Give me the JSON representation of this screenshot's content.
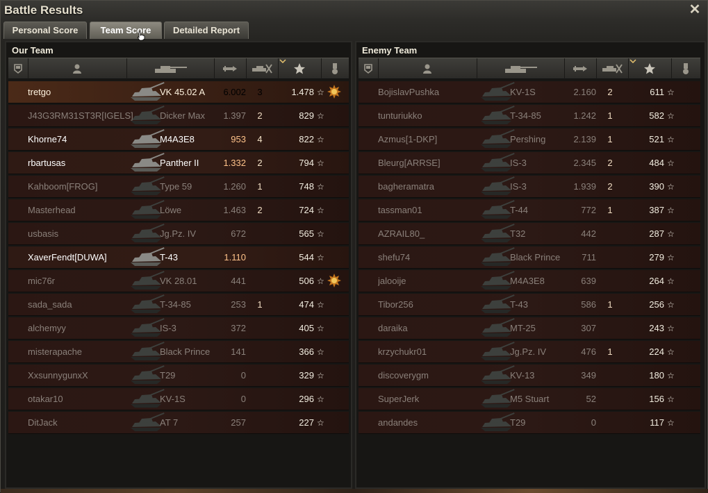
{
  "window": {
    "title": "Battle Results",
    "close_symbol": "✕"
  },
  "tabs": [
    {
      "label": "Personal Score",
      "active": false
    },
    {
      "label": "Team Score",
      "active": true
    },
    {
      "label": "Detailed Report",
      "active": false
    }
  ],
  "our_team": {
    "title": "Our Team",
    "columns": [
      "squad-icon",
      "player-icon",
      "vehicle-icon",
      "damage-icon",
      "kills-icon",
      "experience-star-icon",
      "medal-icon"
    ],
    "rows": [
      {
        "name": "tretgo",
        "vehicle": "VK 45.02 A",
        "damage": "6.002",
        "kills": "3",
        "xp": "1.478",
        "state": "player",
        "medal": true
      },
      {
        "name": "J43G3RM31ST3R[IGELS]",
        "vehicle": "Dicker Max",
        "damage": "1.397",
        "kills": "2",
        "xp": "829",
        "state": "dead",
        "medal": false
      },
      {
        "name": "Khorne74",
        "vehicle": "M4A3E8",
        "damage": "953",
        "kills": "4",
        "xp": "822",
        "state": "alive",
        "medal": false
      },
      {
        "name": "rbartusas",
        "vehicle": "Panther II",
        "damage": "1.332",
        "kills": "2",
        "xp": "794",
        "state": "alive",
        "medal": false
      },
      {
        "name": "Kahboom[FROG]",
        "vehicle": "Type 59",
        "damage": "1.260",
        "kills": "1",
        "xp": "748",
        "state": "dead",
        "medal": false
      },
      {
        "name": "Masterhead",
        "vehicle": "Löwe",
        "damage": "1.463",
        "kills": "2",
        "xp": "724",
        "state": "dead",
        "medal": false
      },
      {
        "name": "usbasis",
        "vehicle": "Jg.Pz. IV",
        "damage": "672",
        "kills": "",
        "xp": "565",
        "state": "dead",
        "medal": false
      },
      {
        "name": "XaverFendt[DUWA]",
        "vehicle": "T-43",
        "damage": "1.110",
        "kills": "",
        "xp": "544",
        "state": "alive",
        "medal": false
      },
      {
        "name": "mic76r",
        "vehicle": "VK 28.01",
        "damage": "441",
        "kills": "",
        "xp": "506",
        "state": "dead",
        "medal": true
      },
      {
        "name": "sada_sada",
        "vehicle": "T-34-85",
        "damage": "253",
        "kills": "1",
        "xp": "474",
        "state": "dead",
        "medal": false
      },
      {
        "name": "alchemyy",
        "vehicle": "IS-3",
        "damage": "372",
        "kills": "",
        "xp": "405",
        "state": "dead",
        "medal": false
      },
      {
        "name": "misterapache",
        "vehicle": "Black Prince",
        "damage": "141",
        "kills": "",
        "xp": "366",
        "state": "dead",
        "medal": false
      },
      {
        "name": "XxsunnygunxX",
        "vehicle": "T29",
        "damage": "0",
        "kills": "",
        "xp": "329",
        "state": "dead",
        "medal": false
      },
      {
        "name": "otakar10",
        "vehicle": "KV-1S",
        "damage": "0",
        "kills": "",
        "xp": "296",
        "state": "dead",
        "medal": false
      },
      {
        "name": "DitJack",
        "vehicle": "AT 7",
        "damage": "257",
        "kills": "",
        "xp": "227",
        "state": "dead",
        "medal": false
      }
    ]
  },
  "enemy_team": {
    "title": "Enemy Team",
    "rows": [
      {
        "name": "BojislavPushka",
        "vehicle": "KV-1S",
        "damage": "2.160",
        "kills": "2",
        "xp": "611",
        "state": "dead"
      },
      {
        "name": "tunturiukko",
        "vehicle": "T-34-85",
        "damage": "1.242",
        "kills": "1",
        "xp": "582",
        "state": "dead"
      },
      {
        "name": "Azmus[1-DKP]",
        "vehicle": "Pershing",
        "damage": "2.139",
        "kills": "1",
        "xp": "521",
        "state": "dead"
      },
      {
        "name": "Bleurg[ARRSE]",
        "vehicle": "IS-3",
        "damage": "2.345",
        "kills": "2",
        "xp": "484",
        "state": "dead"
      },
      {
        "name": "bagheramatra",
        "vehicle": "IS-3",
        "damage": "1.939",
        "kills": "2",
        "xp": "390",
        "state": "dead"
      },
      {
        "name": "tassman01",
        "vehicle": "T-44",
        "damage": "772",
        "kills": "1",
        "xp": "387",
        "state": "dead"
      },
      {
        "name": "AZRAIL80_",
        "vehicle": "T32",
        "damage": "442",
        "kills": "",
        "xp": "287",
        "state": "dead"
      },
      {
        "name": "shefu74",
        "vehicle": "Black Prince",
        "damage": "711",
        "kills": "",
        "xp": "279",
        "state": "dead"
      },
      {
        "name": "jalooije",
        "vehicle": "M4A3E8",
        "damage": "639",
        "kills": "",
        "xp": "264",
        "state": "dead"
      },
      {
        "name": "Tibor256",
        "vehicle": "T-43",
        "damage": "586",
        "kills": "1",
        "xp": "256",
        "state": "dead"
      },
      {
        "name": "daraika",
        "vehicle": "MT-25",
        "damage": "307",
        "kills": "",
        "xp": "243",
        "state": "dead"
      },
      {
        "name": "krzychukr01",
        "vehicle": "Jg.Pz. IV",
        "damage": "476",
        "kills": "1",
        "xp": "224",
        "state": "dead"
      },
      {
        "name": "discoverygm",
        "vehicle": "KV-13",
        "damage": "349",
        "kills": "",
        "xp": "180",
        "state": "dead"
      },
      {
        "name": "SuperJerk",
        "vehicle": "M5 Stuart",
        "damage": "52",
        "kills": "",
        "xp": "156",
        "state": "dead"
      },
      {
        "name": "andandes",
        "vehicle": "T29",
        "damage": "0",
        "kills": "",
        "xp": "117",
        "state": "dead"
      }
    ]
  },
  "xp_star_symbol": "☆"
}
